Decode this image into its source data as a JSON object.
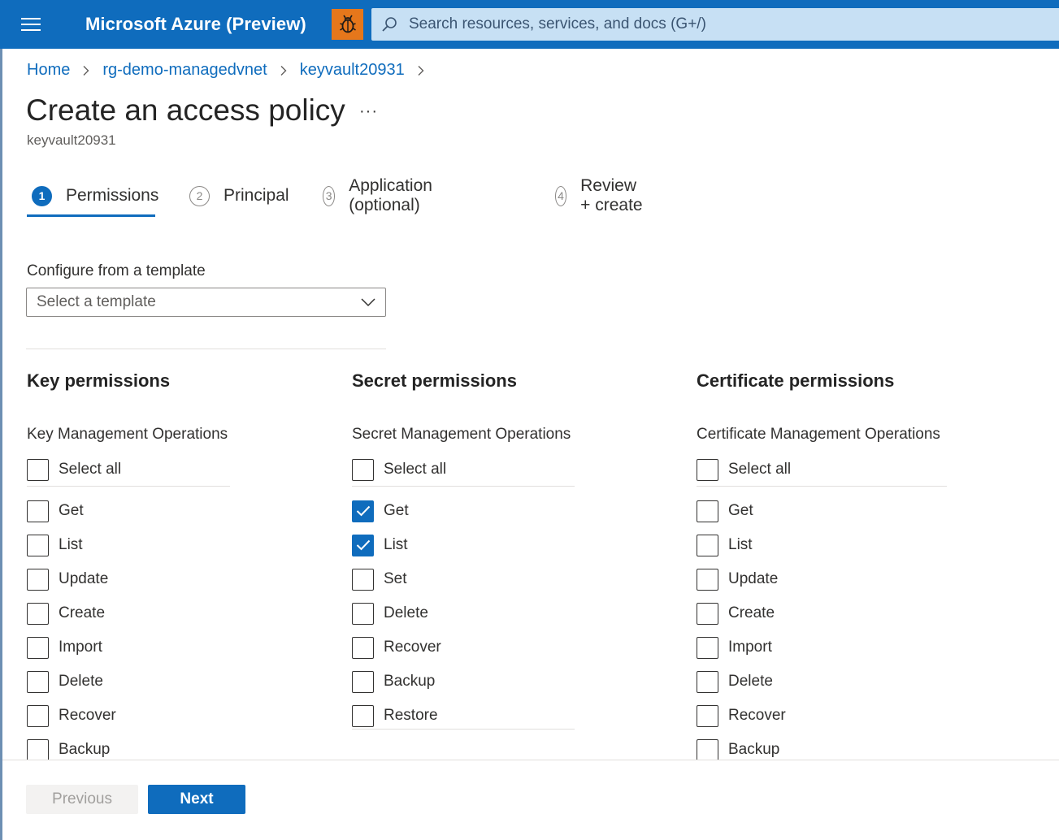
{
  "header": {
    "brand": "Microsoft Azure (Preview)",
    "search_placeholder": "Search resources, services, and docs (G+/)"
  },
  "breadcrumb": [
    "Home",
    "rg-demo-managedvnet",
    "keyvault20931"
  ],
  "page": {
    "title": "Create an access policy",
    "more": "···",
    "subtitle": "keyvault20931"
  },
  "tabs": [
    {
      "num": "1",
      "label": "Permissions",
      "active": true
    },
    {
      "num": "2",
      "label": "Principal",
      "active": false
    },
    {
      "num": "3",
      "label": "Application (optional)",
      "active": false
    },
    {
      "num": "4",
      "label": "Review + create",
      "active": false
    }
  ],
  "template": {
    "label": "Configure from a template",
    "placeholder": "Select a template"
  },
  "columns": [
    {
      "title": "Key permissions",
      "section": "Key Management Operations",
      "select_all": "Select all",
      "items": [
        {
          "label": "Get",
          "checked": false
        },
        {
          "label": "List",
          "checked": false
        },
        {
          "label": "Update",
          "checked": false
        },
        {
          "label": "Create",
          "checked": false
        },
        {
          "label": "Import",
          "checked": false
        },
        {
          "label": "Delete",
          "checked": false
        },
        {
          "label": "Recover",
          "checked": false
        },
        {
          "label": "Backup",
          "checked": false
        }
      ]
    },
    {
      "title": "Secret permissions",
      "section": "Secret Management Operations",
      "select_all": "Select all",
      "items": [
        {
          "label": "Get",
          "checked": true
        },
        {
          "label": "List",
          "checked": true
        },
        {
          "label": "Set",
          "checked": false
        },
        {
          "label": "Delete",
          "checked": false
        },
        {
          "label": "Recover",
          "checked": false
        },
        {
          "label": "Backup",
          "checked": false
        },
        {
          "label": "Restore",
          "checked": false
        }
      ]
    },
    {
      "title": "Certificate permissions",
      "section": "Certificate Management Operations",
      "select_all": "Select all",
      "items": [
        {
          "label": "Get",
          "checked": false
        },
        {
          "label": "List",
          "checked": false
        },
        {
          "label": "Update",
          "checked": false
        },
        {
          "label": "Create",
          "checked": false
        },
        {
          "label": "Import",
          "checked": false
        },
        {
          "label": "Delete",
          "checked": false
        },
        {
          "label": "Recover",
          "checked": false
        },
        {
          "label": "Backup",
          "checked": false
        }
      ]
    }
  ],
  "footer": {
    "previous": "Previous",
    "next": "Next"
  },
  "colors": {
    "accent": "#0f6cbd",
    "bug_button": "#e6771b",
    "search_bg": "#c7e0f4"
  }
}
